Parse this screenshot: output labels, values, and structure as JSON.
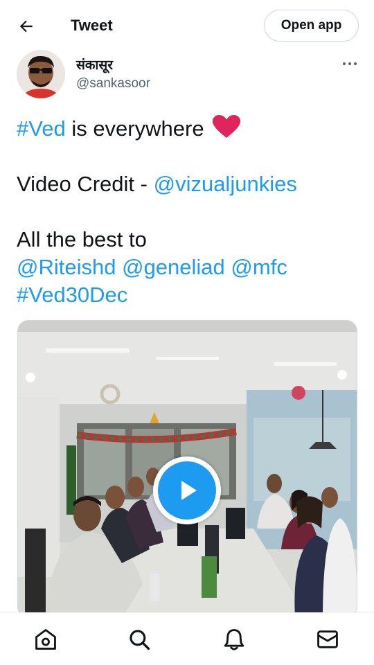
{
  "header": {
    "title": "Tweet",
    "open_app_label": "Open app"
  },
  "author": {
    "display_name": "संकासूर",
    "handle": "@sankasoor"
  },
  "tweet": {
    "line1_hashtag": "#Ved",
    "line1_text": " is everywhere ",
    "line2_text": "Video Credit - ",
    "line2_mention": "@vizualjunkies",
    "line3_text": "All the best to",
    "mention_riteish": "@Riteishd",
    "mention_genelia": "@geneliad",
    "mention_mfc": "@mfc",
    "hashtag_ved30dec": "#Ved30Dec"
  },
  "colors": {
    "link": "#1d9bf0",
    "heart": "#e0245e"
  },
  "icons": {
    "back": "arrow-left-icon",
    "more": "more-horizontal-icon",
    "heart": "red-heart-emoji",
    "play": "play-icon",
    "home": "home-icon",
    "search": "search-icon",
    "notifications": "bell-icon",
    "messages": "mail-icon"
  }
}
